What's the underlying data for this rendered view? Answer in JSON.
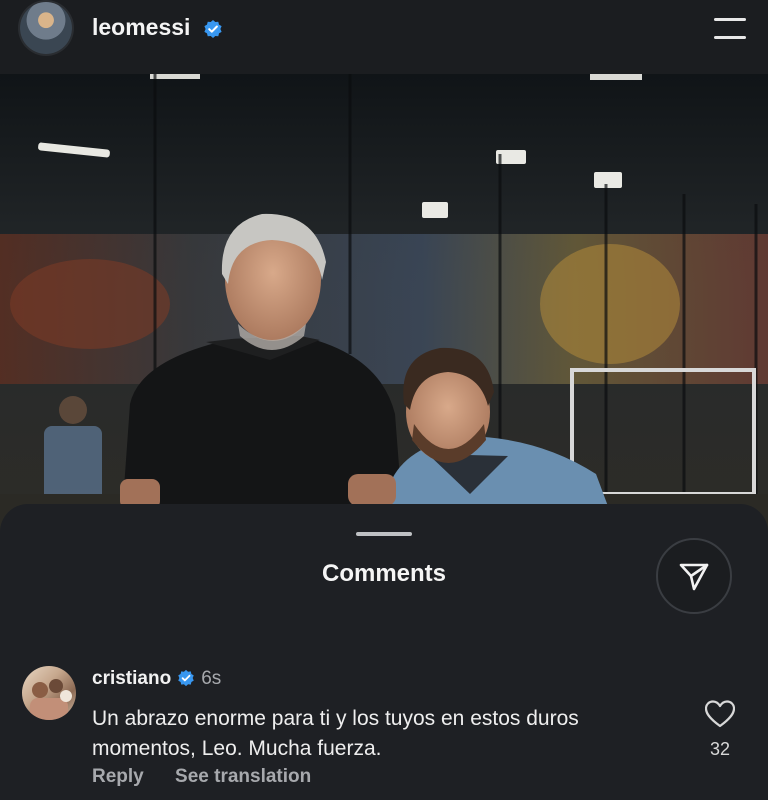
{
  "header": {
    "username": "leomessi",
    "avatar_icon": "profile-avatar",
    "verified_icon": "verified-badge-icon",
    "menu_icon": "hamburger-menu-icon"
  },
  "photo": {
    "description_icon": "post-photo"
  },
  "comments_sheet": {
    "title": "Comments",
    "share_icon": "send-icon"
  },
  "comment": {
    "username": "cristiano",
    "time": "6s",
    "text": "Un abrazo enorme para ti y los tuyos en estos duros momentos, Leo. Mucha fuerza.",
    "reply_label": "Reply",
    "translation_label": "See translation",
    "like_count": "32",
    "like_icon": "heart-icon"
  },
  "colors": {
    "background": "#16181c",
    "sheet": "#1e2024",
    "verified": "#3897f0",
    "muted_text": "#a7a9ad"
  }
}
